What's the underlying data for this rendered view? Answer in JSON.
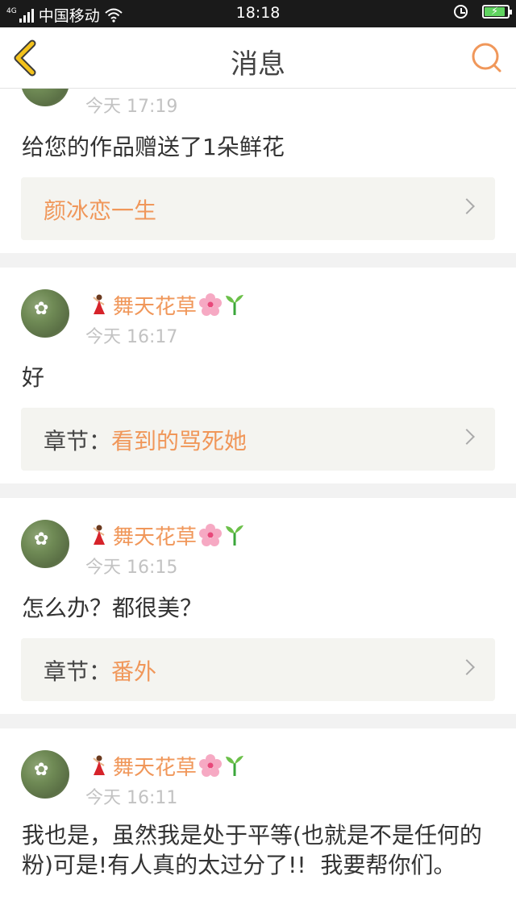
{
  "status_bar": {
    "network": "4G",
    "carrier": "中国移动",
    "time": "18:18"
  },
  "header": {
    "title": "消息",
    "back_icon": "chevron-left-icon",
    "search_icon": "search-icon",
    "accent_color": "#f0975a"
  },
  "messages": [
    {
      "time": "今天 17:19",
      "text": "给您的作品赠送了1朵鲜花",
      "link_label": "",
      "link_value": "颜冰恋一生"
    },
    {
      "user": "舞天花草",
      "time": "今天 16:17",
      "text": "好",
      "link_label": "章节：",
      "link_value": "看到的骂死她"
    },
    {
      "user": "舞天花草",
      "time": "今天 16:15",
      "text": "怎么办？都很美？",
      "link_label": "章节：",
      "link_value": "番外"
    },
    {
      "user": "舞天花草",
      "time": "今天 16:11",
      "text": "我也是，虽然我是处于平等(也就是不是任何的粉)可是!有人真的太过分了!!  我要帮你们。"
    }
  ]
}
